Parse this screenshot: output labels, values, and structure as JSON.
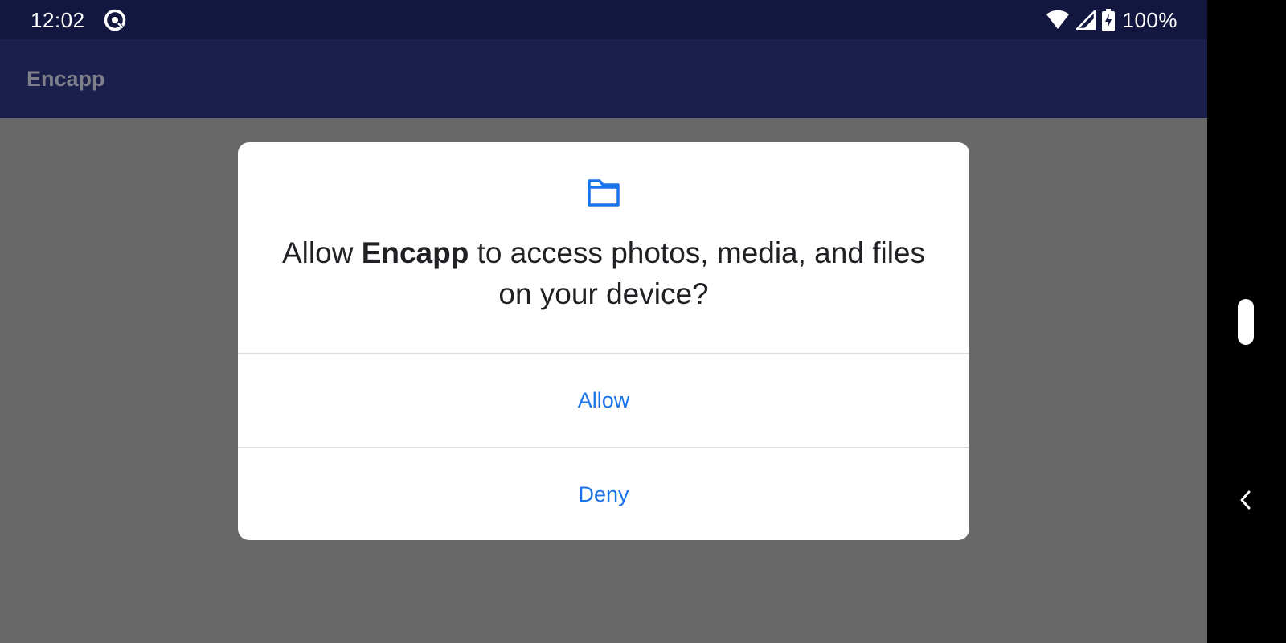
{
  "status_bar": {
    "time": "12:02",
    "app_icon": "privacy-dot-icon",
    "wifi_icon": "wifi-icon",
    "signal_icon": "cell-signal-icon",
    "battery_icon": "battery-charging-icon",
    "battery_level": "100%"
  },
  "app_bar": {
    "title": "Encapp"
  },
  "dialog": {
    "icon": "folder-icon",
    "message_prefix": "Allow ",
    "app_name": "Encapp",
    "message_suffix": " to access photos, media, and files on your device?",
    "allow_label": "Allow",
    "deny_label": "Deny"
  },
  "navigation": {
    "home_handle": "home-pill",
    "back_icon": "back-chevron-icon"
  },
  "colors": {
    "status_bar_bg": "#13173f",
    "app_bar_bg": "#1b1f4b",
    "scrim": "#686868",
    "dialog_bg": "#ffffff",
    "accent": "#1a73e8",
    "text_primary": "#202124"
  }
}
